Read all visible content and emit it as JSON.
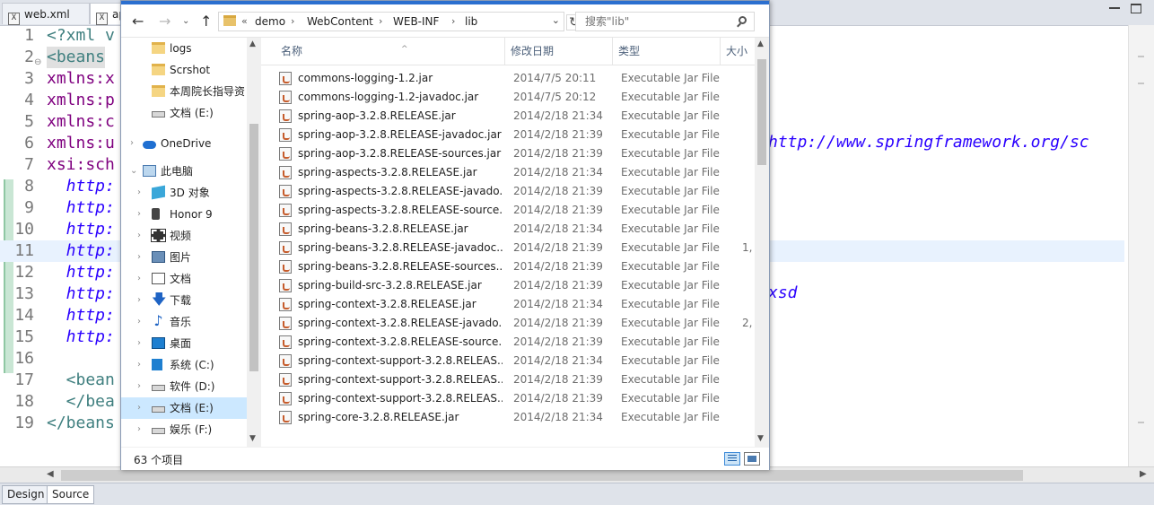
{
  "editor": {
    "tabs": [
      {
        "label": "web.xml",
        "icon": "xml-file-icon"
      },
      {
        "label": "ap",
        "icon": "xml-file-icon"
      }
    ],
    "lines": [
      {
        "n": "1",
        "text": "<?xml v",
        "cls": ""
      },
      {
        "n": "2",
        "text": "<beans",
        "cls": ""
      },
      {
        "n": "3",
        "text": "xmlns:x",
        "cls": "attr"
      },
      {
        "n": "4",
        "text": "xmlns:p",
        "cls": "attr"
      },
      {
        "n": "5",
        "text": "xmlns:c",
        "cls": "attr"
      },
      {
        "n": "6",
        "text": "xmlns:u",
        "cls": "attr"
      },
      {
        "n": "7",
        "text": "xsi:sch",
        "cls": "attr"
      },
      {
        "n": "8",
        "text": "  http:",
        "cls": "url"
      },
      {
        "n": "9",
        "text": "  http:",
        "cls": "url"
      },
      {
        "n": "10",
        "text": "  http:",
        "cls": "url"
      },
      {
        "n": "11",
        "text": "  http:",
        "cls": "url"
      },
      {
        "n": "12",
        "text": "  http:",
        "cls": "url"
      },
      {
        "n": "13",
        "text": "  http:",
        "cls": "url"
      },
      {
        "n": "14",
        "text": "  http:",
        "cls": "url"
      },
      {
        "n": "15",
        "text": "  http:",
        "cls": "url"
      },
      {
        "n": "16",
        "text": "",
        "cls": ""
      },
      {
        "n": "17",
        "text": "  <bean",
        "cls": ""
      },
      {
        "n": "18",
        "text": "  </bea",
        "cls": ""
      },
      {
        "n": "19",
        "text": "</beans",
        "cls": ""
      }
    ],
    "right_url": "http://www.springframework.org/sc",
    "right_xsd": "xsd",
    "bottom_tabs": {
      "design": "Design",
      "source": "Source"
    }
  },
  "explorer": {
    "breadcrumb": {
      "chevron": "«",
      "segments": [
        "demo",
        "WebContent",
        "WEB-INF",
        "lib"
      ]
    },
    "search": {
      "placeholder": "搜索\"lib\""
    },
    "nav": [
      {
        "label": "logs",
        "icon": "folder-icon",
        "cls": "ic-folder"
      },
      {
        "label": "Scrshot",
        "icon": "folder-icon",
        "cls": "ic-folder"
      },
      {
        "label": "本周院长指导资",
        "icon": "folder-icon",
        "cls": "ic-folder"
      },
      {
        "label": "文档 (E:)",
        "icon": "drive-icon",
        "cls": "ic-drive"
      },
      {
        "label": "OneDrive",
        "icon": "cloud-icon",
        "cls": "ic-cloud"
      },
      {
        "label": "此电脑",
        "icon": "computer-icon",
        "cls": "ic-pc"
      },
      {
        "label": "3D 对象",
        "icon": "cube-icon",
        "cls": "ic-3d"
      },
      {
        "label": "Honor 9",
        "icon": "phone-icon",
        "cls": "ic-phone"
      },
      {
        "label": "视频",
        "icon": "video-icon",
        "cls": "ic-video"
      },
      {
        "label": "图片",
        "icon": "picture-icon",
        "cls": "ic-pic"
      },
      {
        "label": "文档",
        "icon": "document-icon",
        "cls": "ic-doc"
      },
      {
        "label": "下载",
        "icon": "download-icon",
        "cls": "ic-down",
        "glyph": "🡇"
      },
      {
        "label": "音乐",
        "icon": "music-icon",
        "cls": "ic-music",
        "glyph": "♪"
      },
      {
        "label": "桌面",
        "icon": "desktop-icon",
        "cls": "ic-desk"
      },
      {
        "label": "系统 (C:)",
        "icon": "windows-drive-icon",
        "cls": "ic-win"
      },
      {
        "label": "软件 (D:)",
        "icon": "drive-icon",
        "cls": "ic-drive"
      },
      {
        "label": "文档 (E:)",
        "icon": "drive-icon",
        "cls": "ic-drive",
        "selected": true
      },
      {
        "label": "娱乐 (F:)",
        "icon": "drive-icon",
        "cls": "ic-drive"
      }
    ],
    "columns": {
      "name": "名称",
      "date": "修改日期",
      "type": "类型",
      "size": "大小"
    },
    "files": [
      {
        "name": "commons-logging-1.2.jar",
        "date": "2014/7/5 20:11",
        "type": "Executable Jar File",
        "size": ""
      },
      {
        "name": "commons-logging-1.2-javadoc.jar",
        "date": "2014/7/5 20:12",
        "type": "Executable Jar File",
        "size": ""
      },
      {
        "name": "spring-aop-3.2.8.RELEASE.jar",
        "date": "2014/2/18 21:34",
        "type": "Executable Jar File",
        "size": ""
      },
      {
        "name": "spring-aop-3.2.8.RELEASE-javadoc.jar",
        "date": "2014/2/18 21:39",
        "type": "Executable Jar File",
        "size": ""
      },
      {
        "name": "spring-aop-3.2.8.RELEASE-sources.jar",
        "date": "2014/2/18 21:39",
        "type": "Executable Jar File",
        "size": ""
      },
      {
        "name": "spring-aspects-3.2.8.RELEASE.jar",
        "date": "2014/2/18 21:34",
        "type": "Executable Jar File",
        "size": ""
      },
      {
        "name": "spring-aspects-3.2.8.RELEASE-javado...",
        "date": "2014/2/18 21:39",
        "type": "Executable Jar File",
        "size": ""
      },
      {
        "name": "spring-aspects-3.2.8.RELEASE-source...",
        "date": "2014/2/18 21:39",
        "type": "Executable Jar File",
        "size": ""
      },
      {
        "name": "spring-beans-3.2.8.RELEASE.jar",
        "date": "2014/2/18 21:34",
        "type": "Executable Jar File",
        "size": ""
      },
      {
        "name": "spring-beans-3.2.8.RELEASE-javadoc....",
        "date": "2014/2/18 21:39",
        "type": "Executable Jar File",
        "size": "1,"
      },
      {
        "name": "spring-beans-3.2.8.RELEASE-sources....",
        "date": "2014/2/18 21:39",
        "type": "Executable Jar File",
        "size": ""
      },
      {
        "name": "spring-build-src-3.2.8.RELEASE.jar",
        "date": "2014/2/18 21:39",
        "type": "Executable Jar File",
        "size": ""
      },
      {
        "name": "spring-context-3.2.8.RELEASE.jar",
        "date": "2014/2/18 21:34",
        "type": "Executable Jar File",
        "size": ""
      },
      {
        "name": "spring-context-3.2.8.RELEASE-javado...",
        "date": "2014/2/18 21:39",
        "type": "Executable Jar File",
        "size": "2,"
      },
      {
        "name": "spring-context-3.2.8.RELEASE-source...",
        "date": "2014/2/18 21:39",
        "type": "Executable Jar File",
        "size": ""
      },
      {
        "name": "spring-context-support-3.2.8.RELEAS...",
        "date": "2014/2/18 21:34",
        "type": "Executable Jar File",
        "size": ""
      },
      {
        "name": "spring-context-support-3.2.8.RELEAS...",
        "date": "2014/2/18 21:39",
        "type": "Executable Jar File",
        "size": ""
      },
      {
        "name": "spring-context-support-3.2.8.RELEAS...",
        "date": "2014/2/18 21:39",
        "type": "Executable Jar File",
        "size": ""
      },
      {
        "name": "spring-core-3.2.8.RELEASE.jar",
        "date": "2014/2/18 21:34",
        "type": "Executable Jar File",
        "size": ""
      }
    ],
    "status": {
      "count": "63 个项目"
    }
  }
}
